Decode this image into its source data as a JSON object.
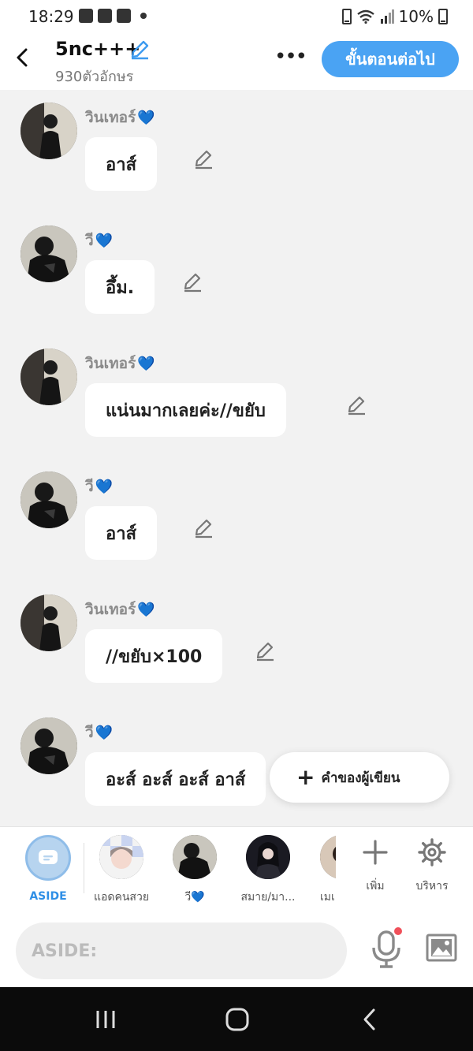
{
  "status_bar": {
    "time": "18:29",
    "dot": "•",
    "battery": "10%"
  },
  "header": {
    "title": "5nc+++",
    "subtitle": "930ตัวอักษร",
    "more_label": "•••",
    "next_label": "ขั้นตอนต่อไป"
  },
  "messages": [
    {
      "sender": "วินเทอร์",
      "heart": "💙",
      "text": "อาส์"
    },
    {
      "sender": "วี",
      "heart": "💙",
      "text": "อึ้ม."
    },
    {
      "sender": "วินเทอร์",
      "heart": "💙",
      "text": "แน่นมากเลยค่ะ//ขยับ"
    },
    {
      "sender": "วี",
      "heart": "💙",
      "text": "อาส์"
    },
    {
      "sender": "วินเทอร์",
      "heart": "💙",
      "text": "//ขยับ×100"
    },
    {
      "sender": "วี",
      "heart": "💙",
      "text": "อะส์ อะส์ อะส์ อาส์"
    }
  ],
  "author_note": {
    "icon": "plus-icon",
    "label": "คำของผู้เขียน"
  },
  "characters": [
    {
      "label": "ASIDE"
    },
    {
      "label": "แอดคนสวย"
    },
    {
      "label": "วี💙"
    },
    {
      "label": "สมาย/มา..."
    },
    {
      "label": "เมเ"
    }
  ],
  "tools": {
    "add_label": "เพิ่ม",
    "manage_label": "บริหาร"
  },
  "input": {
    "placeholder": "ASIDE:"
  },
  "colors": {
    "accent": "#4aa3f3",
    "aside_label": "#2f8fe6",
    "heart": "#1f8fe0",
    "notification_dot": "#f0505a"
  }
}
